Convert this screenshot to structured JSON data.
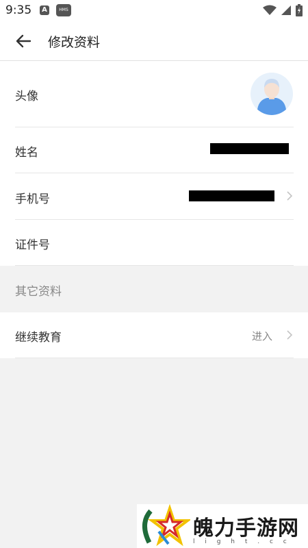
{
  "status_bar": {
    "time": "9:35",
    "icon_a_label": "A",
    "icon_hms_label": "HMS"
  },
  "header": {
    "title": "修改资料"
  },
  "profile": {
    "avatar_label": "头像",
    "name_label": "姓名",
    "phone_label": "手机号",
    "id_label": "证件号"
  },
  "other": {
    "group_title": "其它资料",
    "education_label": "继续教育",
    "education_action": "进入"
  },
  "watermark": {
    "text": "魄力手游网",
    "sub_text": "l i g h t . c c"
  },
  "colors": {
    "background": "#f2f2f2",
    "card": "#ffffff",
    "avatar_blue": "#5a9be8",
    "avatar_bg": "#e7f1fb",
    "redaction": "#000000"
  }
}
